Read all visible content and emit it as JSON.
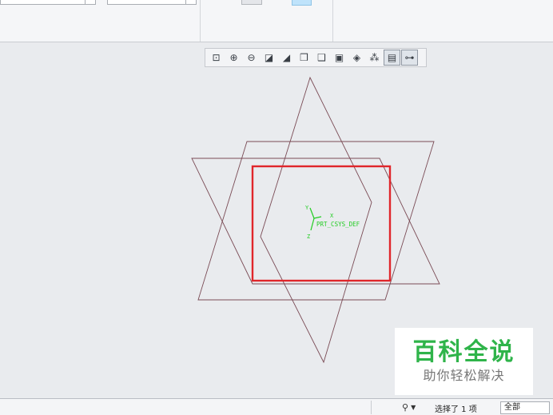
{
  "toolbar": {
    "icons": [
      {
        "name": "refit-icon",
        "glyph": "⊡"
      },
      {
        "name": "zoom-in-icon",
        "glyph": "⊕"
      },
      {
        "name": "zoom-out-icon",
        "glyph": "⊖"
      },
      {
        "name": "repaint-icon",
        "glyph": "◪"
      },
      {
        "name": "display-style-icon",
        "glyph": "◢"
      },
      {
        "name": "saved-orientations-icon",
        "glyph": "❒"
      },
      {
        "name": "view-manager-icon",
        "glyph": "❑"
      },
      {
        "name": "perspective-icon",
        "glyph": "▣"
      },
      {
        "name": "section-icon",
        "glyph": "◈"
      },
      {
        "name": "datum-display-icon",
        "glyph": "⁂"
      },
      {
        "name": "annotation-display-icon",
        "glyph": "▤"
      },
      {
        "name": "spin-center-icon",
        "glyph": "⊶"
      }
    ]
  },
  "model": {
    "csys_label": "PRT_CSYS_DEF",
    "axis_x": "X",
    "axis_y": "Y",
    "axis_z": "Z",
    "line_color": "#7a4b55",
    "highlight_color": "#e0262b",
    "csys_color": "#22cc22"
  },
  "watermark": {
    "title": "百科全说",
    "subtitle": "助你轻松解决"
  },
  "status": {
    "selection_text": "选择了 1 项",
    "filter_value": "全部"
  }
}
